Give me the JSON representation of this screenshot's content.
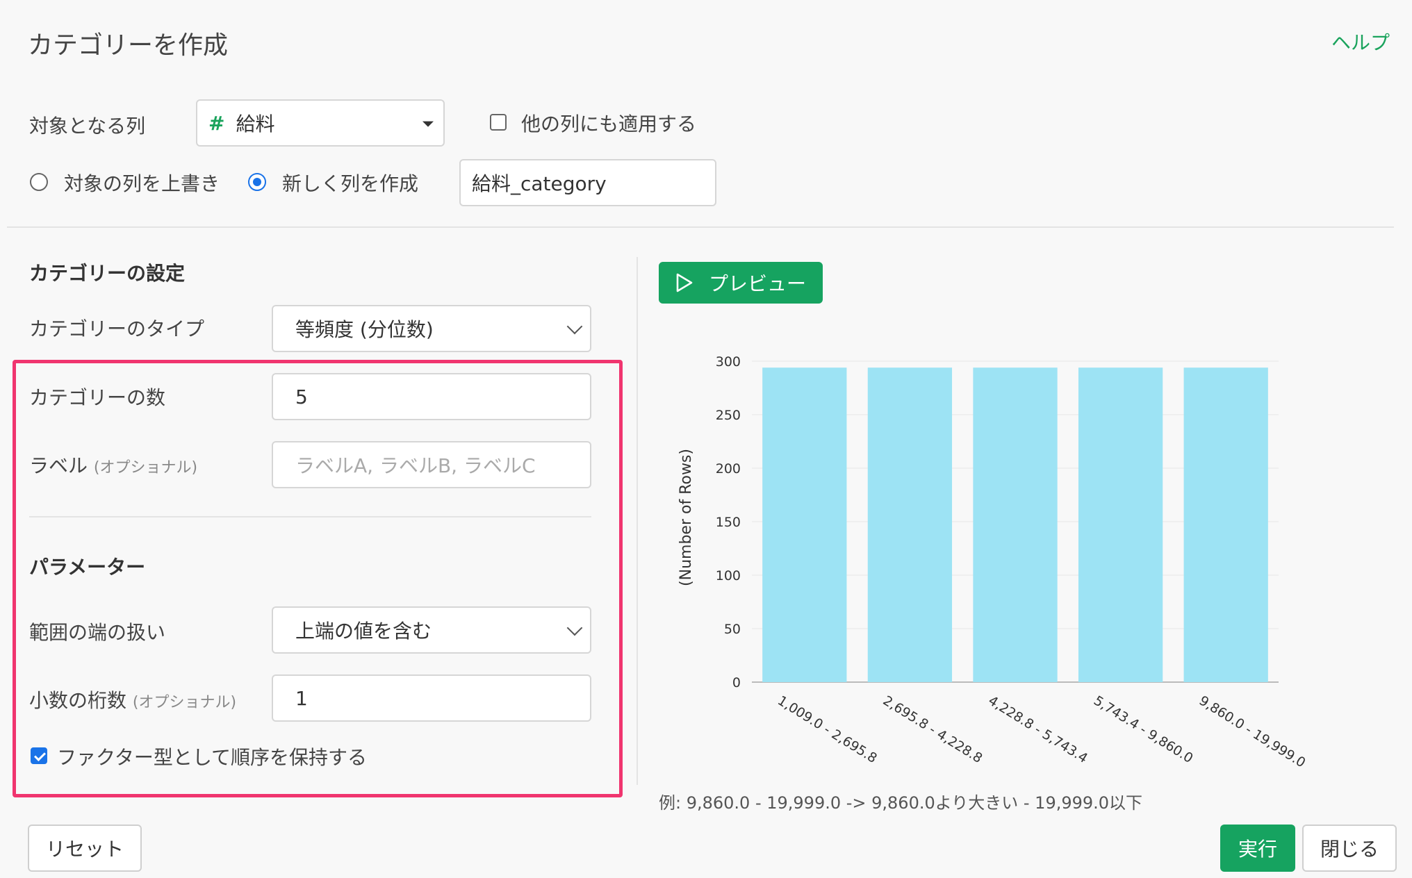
{
  "dialog": {
    "title": "カテゴリーを作成",
    "help_label": "ヘルプ"
  },
  "target": {
    "label": "対象となる列",
    "column_icon": "#",
    "column_value": "給料",
    "apply_other_label": "他の列にも適用する",
    "overwrite_label": "対象の列を上書き",
    "create_new_label": "新しく列を作成",
    "new_column_value": "給料_category"
  },
  "settings": {
    "section_title": "カテゴリーの設定",
    "type_label": "カテゴリーのタイプ",
    "type_value": "等頻度 (分位数)",
    "count_label": "カテゴリーの数",
    "count_value": "5",
    "label_label": "ラベル",
    "optional": "(オプショナル)",
    "label_placeholder": "ラベルA, ラベルB, ラベルC"
  },
  "params": {
    "section_title": "パラメーター",
    "edge_label": "範囲の端の扱い",
    "edge_value": "上端の値を含む",
    "decimal_label": "小数の桁数",
    "decimal_optional": "(オプショナル)",
    "decimal_value": "1",
    "factor_label": "ファクター型として順序を保持する"
  },
  "preview": {
    "button_label": "プレビュー"
  },
  "chart_data": {
    "type": "bar",
    "categories": [
      "1,009.0 - 2,695.8",
      "2,695.8 - 4,228.8",
      "4,228.8 - 5,743.4",
      "5,743.4 - 9,860.0",
      "9,860.0 - 19,999.0"
    ],
    "values": [
      294,
      294,
      294,
      294,
      294
    ],
    "ylabel": "(Number of Rows)",
    "ylim": [
      0,
      300
    ],
    "yticks": [
      "0",
      "50",
      "100",
      "150",
      "200",
      "250",
      "300"
    ],
    "bar_color": "#9de3f4",
    "grid": true
  },
  "example_note": "例: 9,860.0 - 19,999.0 -> 9,860.0より大きい - 19,999.0以下",
  "footer": {
    "reset_label": "リセット",
    "run_label": "実行",
    "close_label": "閉じる"
  },
  "colors": {
    "accent": "#16a360",
    "highlight": "#f0356f",
    "radio": "#1a73e8"
  }
}
